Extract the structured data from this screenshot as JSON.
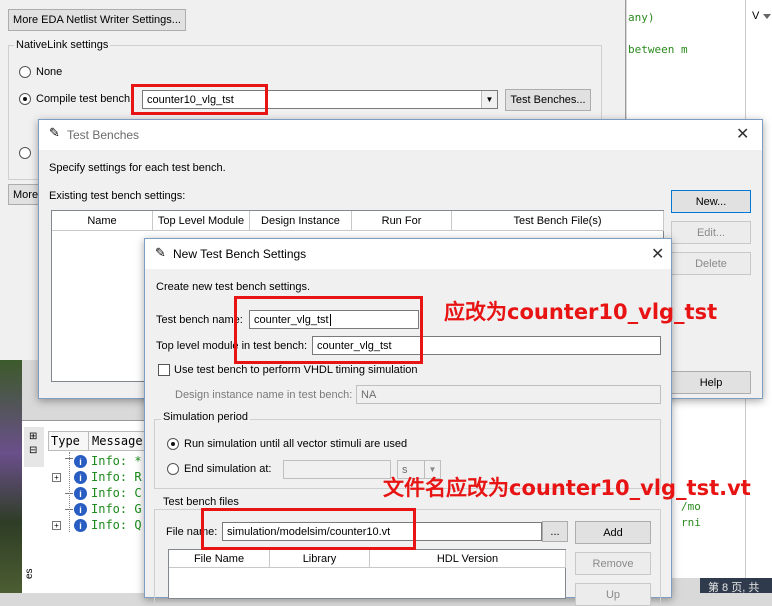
{
  "settings_window": {
    "more_eda_button": "More EDA Netlist Writer Settings...",
    "nativelink_group": "NativeLink settings",
    "radio_none": "None",
    "radio_compile": "Compile test bench:",
    "compile_value": "counter10_vlg_tst",
    "test_benches_button": "Test Benches...",
    "more_button_partial": "More",
    "radio_partial": "S"
  },
  "code_panel": {
    "line1": "any)",
    "line2": "between m",
    "line3": "/mo",
    "line4": "rni"
  },
  "right_strip": {
    "v_label": "V",
    "page_label": "第 8 页, 共"
  },
  "messages_panel": {
    "header_type": "Type",
    "header_message": "Message",
    "left_label": "es",
    "rows": [
      {
        "text": "Info: *"
      },
      {
        "text": "Info: R"
      },
      {
        "text": "Info: C"
      },
      {
        "text": "Info: G"
      },
      {
        "text": "Info: Q"
      }
    ]
  },
  "test_benches_dialog": {
    "title": "Test Benches",
    "specify_text": "Specify settings for each test bench.",
    "existing_label": "Existing test bench settings:",
    "columns": [
      "Name",
      "Top Level Module",
      "Design Instance",
      "Run For",
      "Test Bench File(s)"
    ],
    "new_button": "New...",
    "edit_button": "Edit...",
    "delete_button": "Delete",
    "help_button": "Help"
  },
  "new_tb_dialog": {
    "title": "New Test Bench Settings",
    "create_text": "Create new test bench settings.",
    "name_label": "Test bench name:",
    "name_value": "counter_vlg_tst",
    "top_label": "Top level module in test bench:",
    "top_value": "counter_vlg_tst",
    "vhdl_check": "Use test bench to perform VHDL timing simulation",
    "design_label": "Design instance name in test bench:",
    "design_value": "NA",
    "sim_group": "Simulation period",
    "run_until": "Run simulation until all vector stimuli are used",
    "end_at": "End simulation at:",
    "unit_value": "s",
    "files_group": "Test bench files",
    "file_label": "File name:",
    "file_value": "simulation/modelsim/counter10.vt",
    "browse_button": "...",
    "add_button": "Add",
    "remove_button": "Remove",
    "up_button": "Up",
    "file_columns": [
      "File Name",
      "Library",
      "HDL Version"
    ]
  },
  "annotations": {
    "name_annotation": "应改为counter10_vlg_tst",
    "file_annotation": "文件名应改为counter10_vlg_tst.vt"
  }
}
